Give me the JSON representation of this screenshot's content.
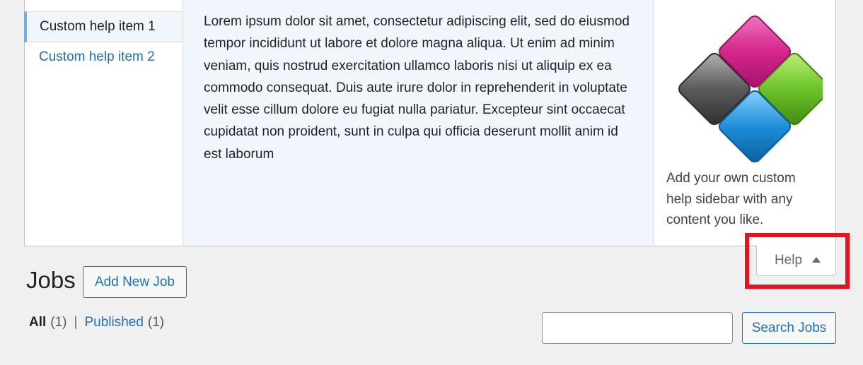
{
  "help": {
    "tabs": [
      {
        "label": "Custom help item 1",
        "active": true
      },
      {
        "label": "Custom help item 2",
        "active": false
      }
    ],
    "content": "Lorem ipsum dolor sit amet, consectetur adipiscing elit, sed do eiusmod tempor incididunt ut labore et dolore magna aliqua. Ut enim ad minim veniam, quis nostrud exercitation ullamco laboris nisi ut aliquip ex ea commodo consequat. Duis aute irure dolor in reprehenderit in voluptate velit esse cillum dolore eu fugiat nulla pariatur. Excepteur sint occaecat cupidatat non proident, sunt in culpa qui officia deserunt mollit anim id est laborum",
    "sidebar_text": "Add your own custom help sidebar with any content you like.",
    "toggle_label": "Help"
  },
  "page": {
    "title": "Jobs",
    "add_new_label": "Add New Job"
  },
  "filters": {
    "all_label": "All",
    "all_count": "(1)",
    "separator": "|",
    "published_label": "Published",
    "published_count": "(1)"
  },
  "search": {
    "value": "",
    "button_label": "Search Jobs"
  },
  "colors": {
    "accent": "#2271b1",
    "highlight": "#e5131e",
    "logo_pink": "#d6258c",
    "logo_green": "#6cc32a",
    "logo_blue": "#1e8fd8",
    "logo_gray": "#5a5a5a"
  }
}
